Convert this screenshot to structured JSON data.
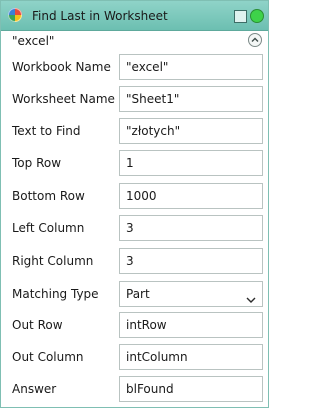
{
  "window": {
    "title": "Find Last in Worksheet"
  },
  "summary": "\"excel\"",
  "fields": {
    "workbook_name": {
      "label": "Workbook Name",
      "value": "\"excel\""
    },
    "worksheet_name": {
      "label": "Worksheet Name",
      "value": "\"Sheet1\""
    },
    "text_to_find": {
      "label": "Text to Find",
      "value": "\"złotych\""
    },
    "top_row": {
      "label": "Top Row",
      "value": "1"
    },
    "bottom_row": {
      "label": "Bottom Row",
      "value": "1000"
    },
    "left_column": {
      "label": "Left Column",
      "value": "3"
    },
    "right_column": {
      "label": "Right Column",
      "value": "3"
    },
    "matching_type": {
      "label": "Matching Type",
      "value": "Part"
    },
    "out_row": {
      "label": "Out Row",
      "value": "intRow"
    },
    "out_column": {
      "label": "Out Column",
      "value": "intColumn"
    },
    "answer": {
      "label": "Answer",
      "value": "blFound"
    }
  },
  "colors": {
    "titlebar": "#6cbfb1",
    "status": "#3ed24a"
  }
}
